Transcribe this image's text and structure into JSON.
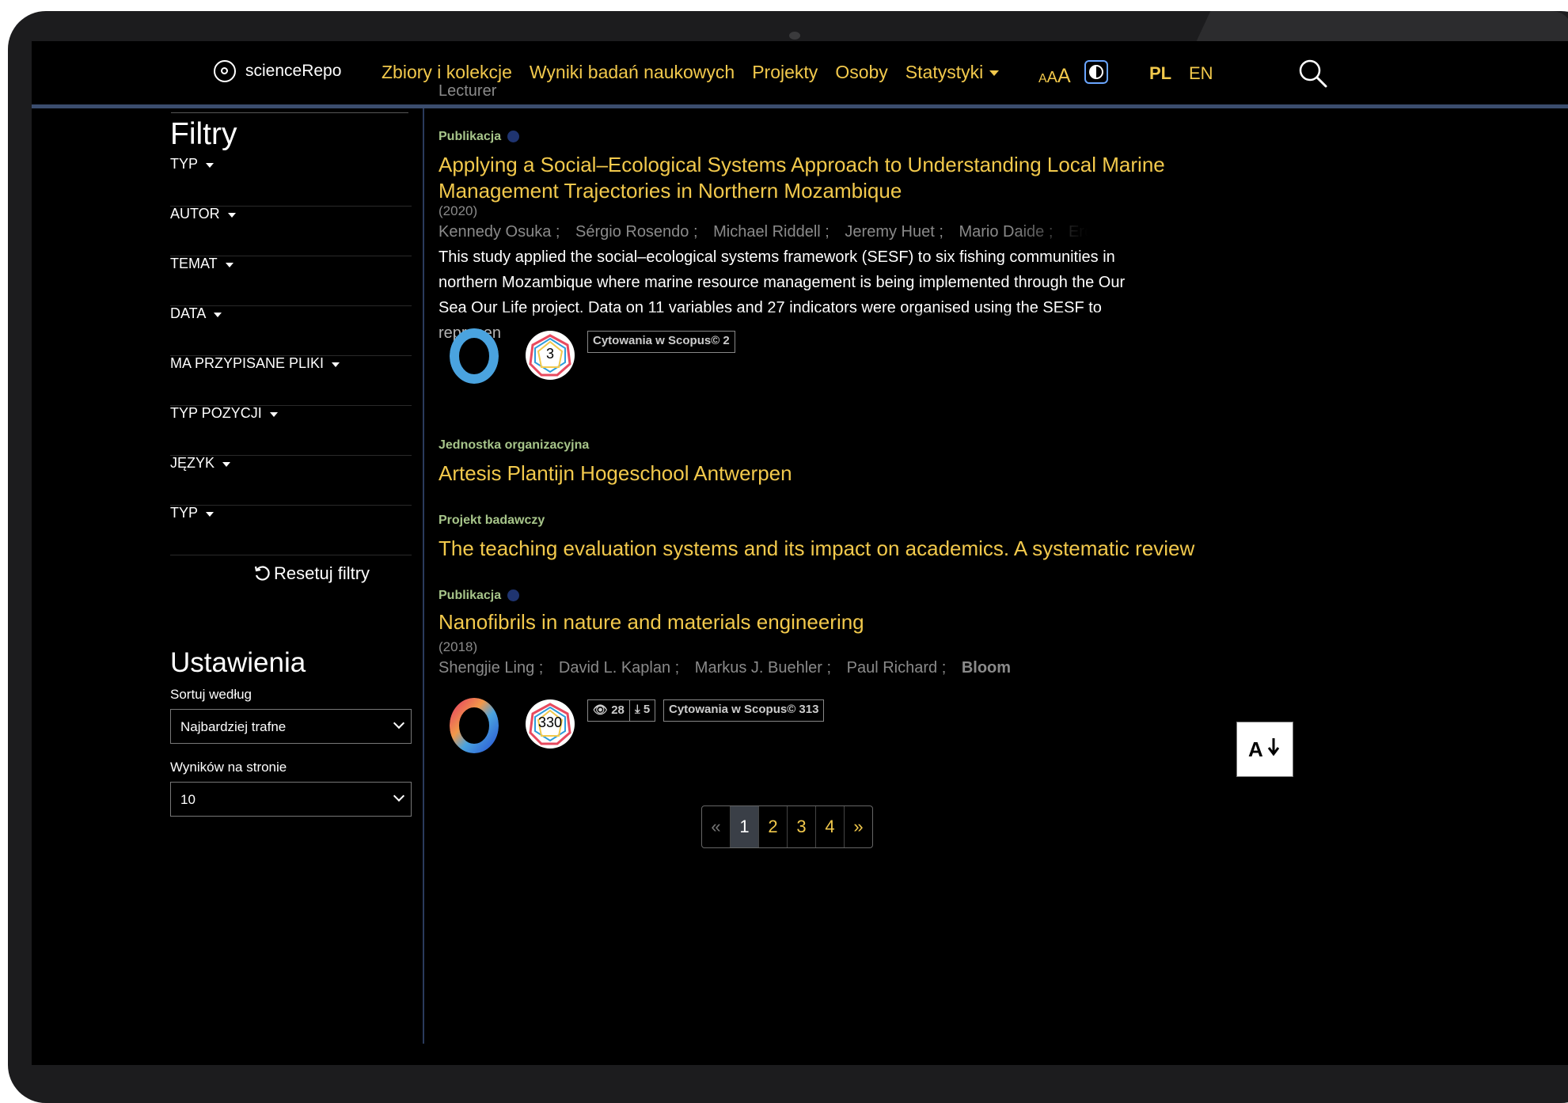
{
  "header": {
    "logo_text": "scienceRepo",
    "nav": [
      "Zbiory i kolekcje",
      "Wyniki badań naukowych",
      "Projekty",
      "Osoby",
      "Statystyki"
    ],
    "fontsize_labels": [
      "A",
      "A",
      "A"
    ],
    "lang_pl": "PL",
    "lang_en": "EN"
  },
  "sidebar": {
    "filters_title": "Filtry",
    "filters": [
      "TYP",
      "AUTOR",
      "TEMAT",
      "DATA",
      "MA PRZYPISANE PLIKI",
      "TYP POZYCJI",
      "JĘZYK",
      "TYP"
    ],
    "reset_label": "Resetuj filtry",
    "settings_title": "Ustawienia",
    "sort_label": "Sortuj według",
    "sort_value": "Najbardziej trafne",
    "per_page_label": "Wyników na stronie",
    "per_page_value": "10"
  },
  "results": {
    "cut_text": "Lecturer",
    "r1": {
      "type": "Publikacja",
      "title": "Applying a Social–Ecological Systems Approach to Understanding Local Marine Management Trajectories in Northern Mozambique",
      "year": "(2020)",
      "authors": [
        "Kennedy Osuka ;",
        "Sérgio Rosendo ;",
        "Michael Riddell ;",
        "Jeremy Huet ;",
        "Mario Daide ;",
        "Ercilio Chau"
      ],
      "abstract": "This study applied the social–ecological systems framework (SESF) to six fishing communities in northern Mozambique where marine resource management is being implemented through the Our Sea Our Life project. Data on 11 variables and 27 indicators were organised using the SESF to represen",
      "dimensions_count": "3",
      "scopus_badge": "Cytowania w Scopus© 2"
    },
    "r2": {
      "type": "Jednostka organizacyjna",
      "title": "Artesis Plantijn Hogeschool Antwerpen"
    },
    "r3": {
      "type": "Projekt badawczy",
      "title": "The teaching evaluation systems and its impact on academics. A systematic review"
    },
    "r4": {
      "type": "Publikacja",
      "title": "Nanofibrils in nature and materials engineering",
      "year": "(2018)",
      "authors": [
        "Shengjie Ling ;",
        "David L. Kaplan ;",
        "Markus J. Buehler ;",
        "Paul Richard ;",
        "Bloom"
      ],
      "dimensions_count": "330",
      "views": "28",
      "downloads": "5",
      "scopus_badge": "Cytowania w Scopus© 313"
    }
  },
  "pagination": {
    "prev": "«",
    "pages": [
      "1",
      "2",
      "3",
      "4"
    ],
    "next": "»",
    "current": "1"
  },
  "colors": {
    "accent": "#f2c94c",
    "type_label": "#a7c58a",
    "background": "#000000"
  }
}
